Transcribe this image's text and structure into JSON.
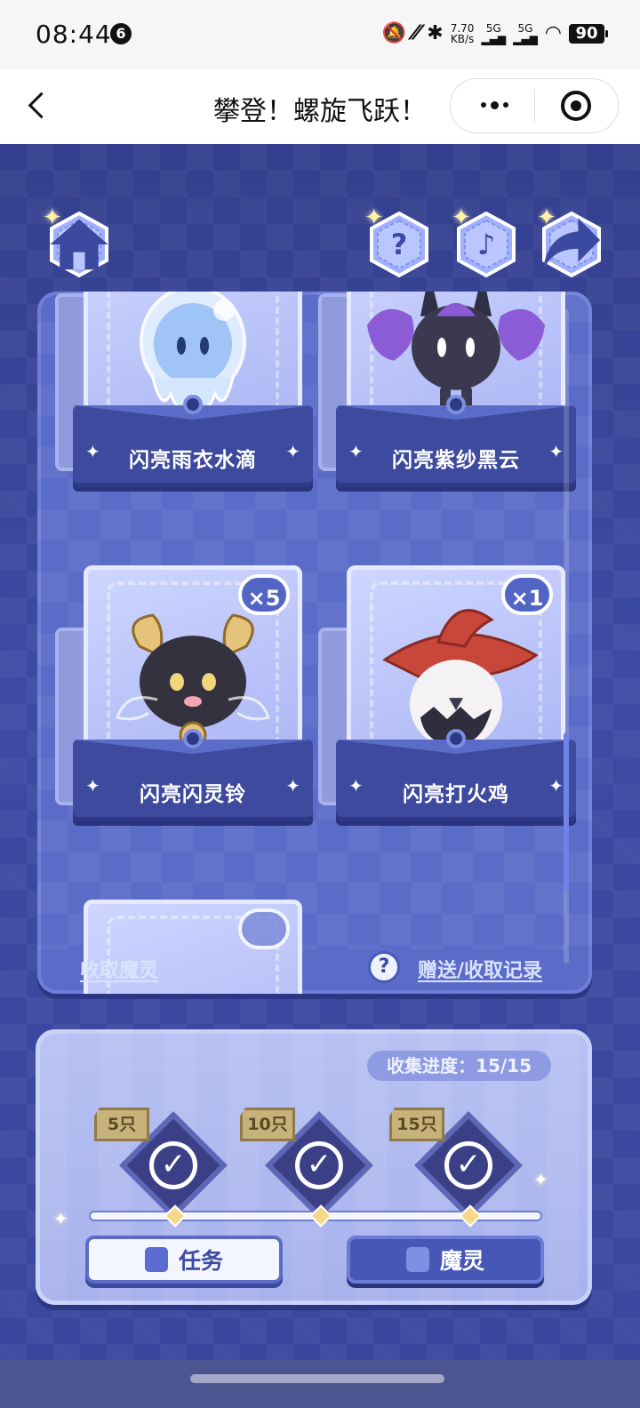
{
  "status_bar": {
    "time": "08:44",
    "notification_count": "6",
    "net_speed_value": "7.70",
    "net_speed_unit": "KB/s",
    "signal_1_label": "5G",
    "signal_2_label": "5G",
    "battery": "90"
  },
  "titlebar": {
    "title": "攀登！螺旋飞跃！"
  },
  "cards": [
    {
      "name": "闪亮雨衣水滴",
      "count": ""
    },
    {
      "name": "闪亮紫纱黑云",
      "count": ""
    },
    {
      "name": "闪亮闪灵铃",
      "count": "×5"
    },
    {
      "name": "闪亮打火鸡",
      "count": "×1"
    }
  ],
  "panel_footer": {
    "collect_link": "收取魔灵",
    "records_link": "赠送/收取记录",
    "help_icon": "?"
  },
  "progress": {
    "label": "收集进度：15/15",
    "collected": 15,
    "total": 15,
    "milestones": [
      {
        "tag": "5只",
        "completed": true
      },
      {
        "tag": "10只",
        "completed": true
      },
      {
        "tag": "15只",
        "completed": true
      }
    ]
  },
  "buttons": {
    "task": "任务",
    "spirit": "魔灵"
  },
  "icons": {
    "home": "house-icon",
    "help": "question-icon",
    "music": "music-note-icon",
    "share": "share-arrow-icon"
  },
  "colors": {
    "background": "#3a479d",
    "panel": "#5b6bc8",
    "progress_panel": "#b7c1f2",
    "accent_gold": "#c7b27c"
  }
}
